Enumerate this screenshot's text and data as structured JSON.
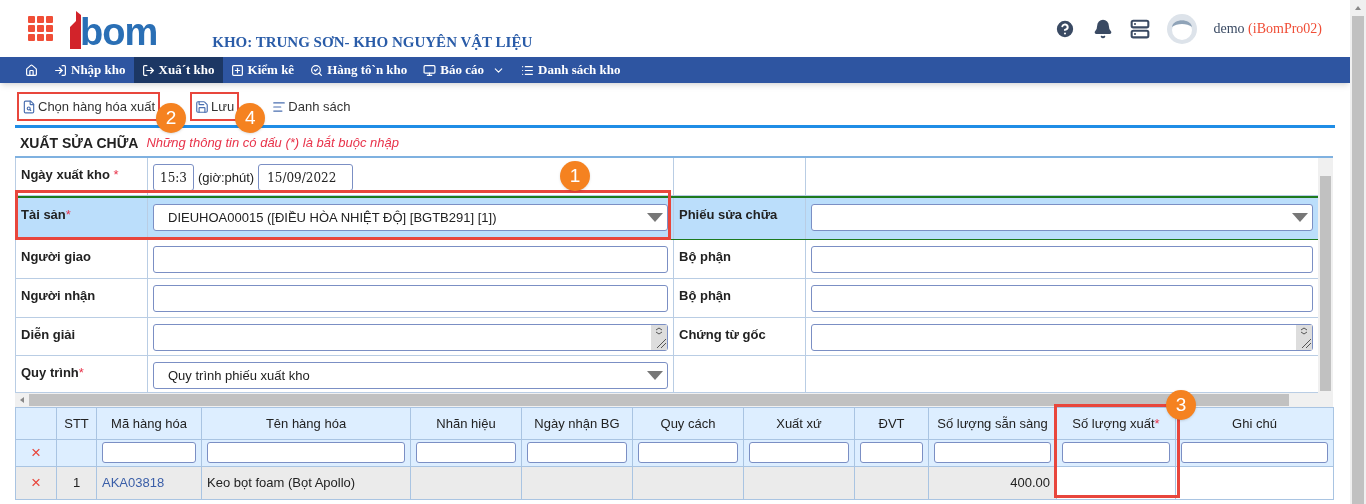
{
  "header": {
    "logo_text": "bom",
    "warehouse": "KHO: TRUNG SƠN- KHO NGUYÊN VẬT LIỆU",
    "user": "demo",
    "account": "(iBomPro02)"
  },
  "nav": [
    {
      "selected": false
    },
    {
      "label": "Nhập kho",
      "selected": false
    },
    {
      "label": "Xuâ´t kho",
      "selected": true
    },
    {
      "label": "Kiểm kê",
      "selected": false
    },
    {
      "label": "Hàng tô`n kho",
      "selected": false
    },
    {
      "label": "Báo cáo",
      "selected": false,
      "dropdown": true
    },
    {
      "label": "Danh sách kho",
      "selected": false
    }
  ],
  "toolbar": [
    {
      "label": "Chọn hàng hóa xuất",
      "highlighted": true,
      "callout": "2"
    },
    {
      "label": "Lưu",
      "highlighted": true,
      "callout": "4"
    },
    {
      "label": "Danh sách",
      "highlighted": false
    }
  ],
  "form_title": "XUẤT SỬA CHỮA",
  "form_note": "Những thông tin có dấu (*) là bắt buộc nhập",
  "form_rows": [
    {
      "highlighted": false,
      "cells": [
        {
          "label": "Ngày xuất kho",
          "mark": "*",
          "kind": "datetime",
          "time": "15:3",
          "unit": "(giờ:phút)",
          "date": "15/09/2022"
        },
        {
          "kind": "empty"
        }
      ],
      "callout": "1"
    },
    {
      "highlighted": true,
      "cells": [
        {
          "label": "Tài sản",
          "mark": "*",
          "kind": "select",
          "value": "DIEUHOA00015 ([ĐIỀU HÒA NHIỆT ĐỘ] [BGTB291] [1])"
        },
        {
          "label": "Phiếu sửa chữa",
          "kind": "select"
        }
      ]
    },
    {
      "highlighted": false,
      "cells": [
        {
          "label": "Người giao",
          "kind": "input"
        },
        {
          "label": "Bộ phận",
          "kind": "input"
        }
      ]
    },
    {
      "highlighted": false,
      "cells": [
        {
          "label": "Người nhận",
          "kind": "input"
        },
        {
          "label": "Bộ phận",
          "kind": "input"
        }
      ]
    },
    {
      "highlighted": false,
      "cells": [
        {
          "label": "Diễn giải",
          "kind": "textarea"
        },
        {
          "label": "Chứng từ gốc",
          "kind": "textarea"
        }
      ]
    },
    {
      "highlighted": false,
      "cells": [
        {
          "label": "Quy trình",
          "mark": "*",
          "kind": "select",
          "value": "Quy trình phiếu xuất kho"
        },
        {
          "kind": "empty"
        }
      ]
    }
  ],
  "grid": {
    "columns": [
      {
        "highlighted": false
      },
      {
        "title": "STT",
        "highlighted": false
      },
      {
        "title": "Mã hàng hóa",
        "highlighted": false
      },
      {
        "title": "Tên hàng hóa",
        "highlighted": false
      },
      {
        "title": "Nhãn hiệu",
        "highlighted": false
      },
      {
        "title": "Ngày nhận BG",
        "highlighted": false
      },
      {
        "title": "Quy cách",
        "highlighted": false
      },
      {
        "title": "Xuất xứ",
        "highlighted": false
      },
      {
        "title": "ĐVT",
        "highlighted": false
      },
      {
        "title": "Số lượng sẵn sàng",
        "highlighted": false
      },
      {
        "title": "Số lượng xuất",
        "mark": "*",
        "highlighted": true,
        "callout": "3"
      },
      {
        "title": "Ghi chú",
        "highlighted": false
      }
    ],
    "filter_delete": "×",
    "rows": [
      {
        "cells": [
          "×",
          "1",
          "AKA03818",
          "Keo bọt foam (Bọt Apollo)",
          "",
          "",
          "",
          "",
          "",
          "400.00",
          "",
          ""
        ]
      }
    ]
  }
}
